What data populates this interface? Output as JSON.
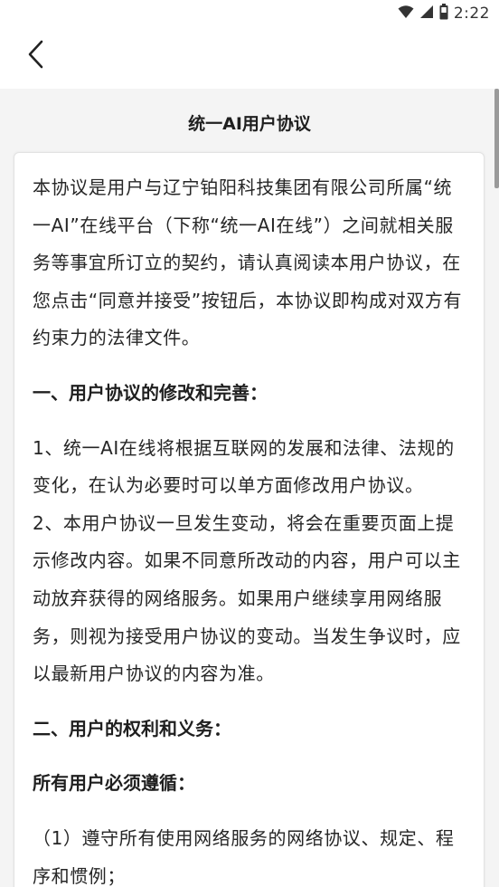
{
  "status_bar": {
    "time": "2:22",
    "icons": [
      "wifi-icon",
      "signal-icon",
      "battery-icon"
    ]
  },
  "app_bar": {
    "back_icon": "chevron-left-icon"
  },
  "document": {
    "title": "统一AI用户协议",
    "intro": "本协议是用户与辽宁铂阳科技集团有限公司所属“统一AI”在线平台（下称“统一AI在线”）之间就相关服务等事宜所订立的契约，请认真阅读本用户协议，在您点击“同意并接受”按钮后，本协议即构成对双方有约束力的法律文件。",
    "section1_heading": "一、用户协议的修改和完善：",
    "section1_item1": "1、统一AI在线将根据互联网的发展和法律、法规的变化，在认为必要时可以单方面修改用户协议。",
    "section1_item2": "2、本用户协议一旦发生变动，将会在重要页面上提示修改内容。如果不同意所改动的内容，用户可以主动放弃获得的网络服务。如果用户继续享用网络服务，则视为接受用户协议的变动。当发生争议时，应以最新用户协议的内容为准。",
    "section2_heading": "二、用户的权利和义务：",
    "section2_subheading": "所有用户必须遵循：",
    "section2_item1": "（1）遵守所有使用网络服务的网络协议、规定、程序和惯例；"
  },
  "colors": {
    "background": "#f4f4f4",
    "card": "#ffffff",
    "text": "#262626",
    "scrollbar": "#9a9a9a"
  }
}
